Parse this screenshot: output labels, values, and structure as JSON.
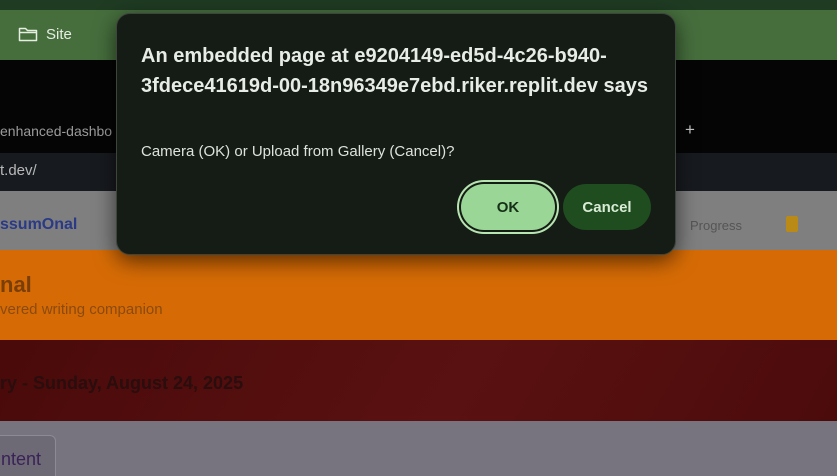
{
  "bookmark_bar": {
    "site_label": "Site"
  },
  "background": {
    "tab_label": "enhanced-dashbo",
    "address_fragment": "t.dev/",
    "brand_fragment": "ssumOnal",
    "nav_right_text": "Progress",
    "banner_title": "nal",
    "banner_subtitle": "vered writing companion",
    "entry_title": "ry - Sunday, August 24, 2025",
    "content_tab_label": "ntent"
  },
  "dialog": {
    "heading": "An embedded page at e9204149-ed5d-4c26-b940-3fdece41619d-00-18n96349e7ebd.riker.replit.dev says",
    "message": "Camera (OK) or Upload from Gallery (Cancel)?",
    "ok_label": "OK",
    "cancel_label": "Cancel"
  },
  "colors": {
    "dialog_bg": "#151b15",
    "ok_bg": "#9ad695",
    "cancel_bg": "#1f4d1f",
    "banner": "#d66b05"
  }
}
